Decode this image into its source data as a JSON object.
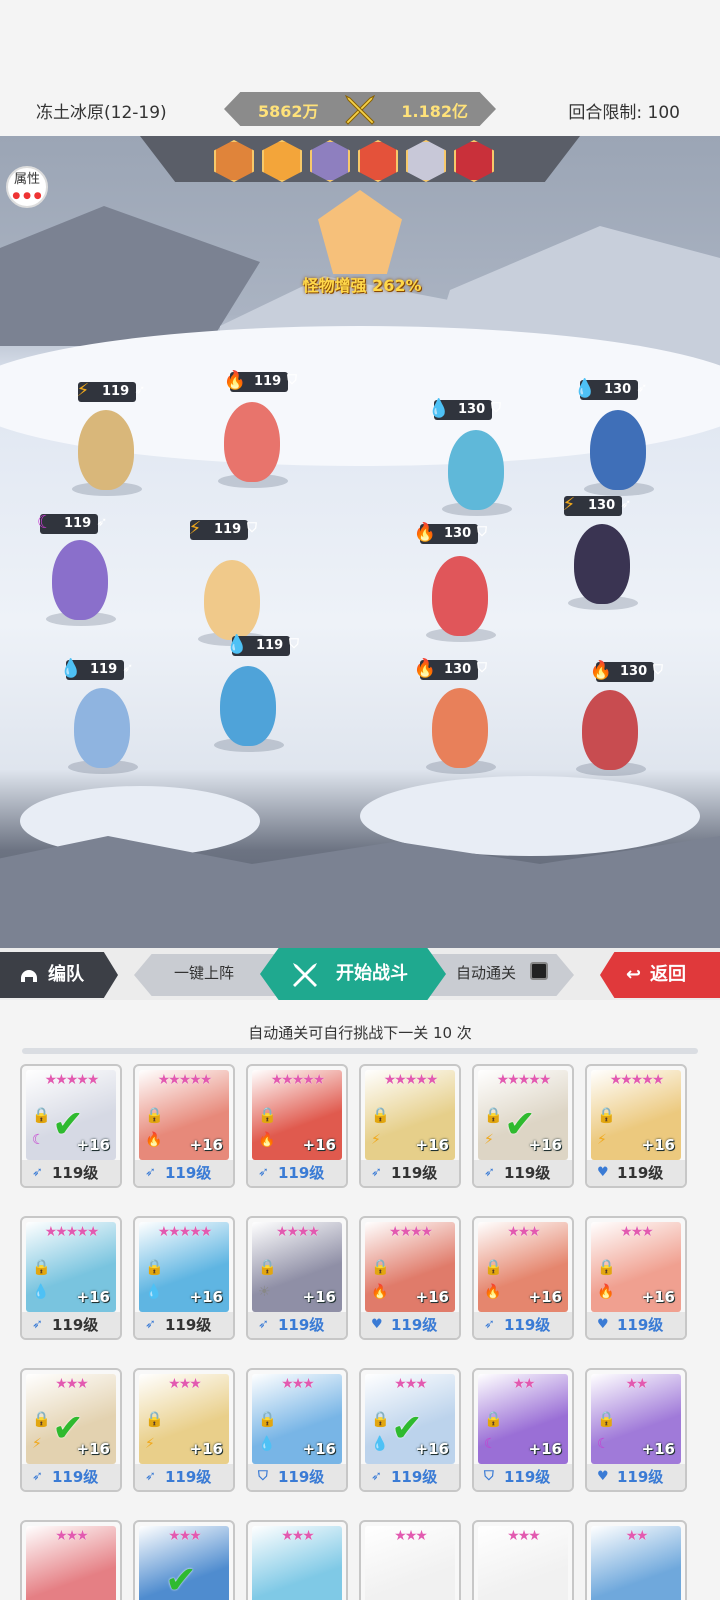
{
  "header": {
    "stage_name": "冻土冰原(12-19)",
    "power_self": "5862万",
    "power_enemy": "1.182亿",
    "round_limit": "回合限制: 100"
  },
  "battlefield": {
    "attr_button": "属性",
    "boss_buff": "怪物增强 262%",
    "enemy_portraits": [
      "#e0843a",
      "#f3a53a",
      "#8e7fbf",
      "#e4523a",
      "#c8c8d8",
      "#c9303a"
    ],
    "allies": [
      {
        "level": "119",
        "element": "thunder-icon",
        "class": "speed-icon",
        "color": "#d9b77a"
      },
      {
        "level": "119",
        "element": "fire-icon",
        "class": "shield-icon",
        "color": "#e8746c"
      },
      {
        "level": "119",
        "element": "moon-icon",
        "class": "speed-icon",
        "color": "#8a6fcb"
      },
      {
        "level": "119",
        "element": "thunder-icon",
        "class": "shield-icon",
        "color": "#f0c98a"
      },
      {
        "level": "119",
        "element": "water-icon",
        "class": "speed-icon",
        "color": "#8fb4e0"
      },
      {
        "level": "119",
        "element": "water-icon",
        "class": "shield-icon",
        "color": "#4fa3d9"
      }
    ],
    "enemies": [
      {
        "level": "130",
        "element": "water-icon",
        "class": "shield-icon",
        "color": "#5fb8d9"
      },
      {
        "level": "130",
        "element": "water-icon",
        "class": "speed-icon",
        "color": "#3f6fb8"
      },
      {
        "level": "130",
        "element": "fire-icon",
        "class": "shield-icon",
        "color": "#e0565a"
      },
      {
        "level": "130",
        "element": "thunder-icon",
        "class": "speed-icon",
        "color": "#3a3452"
      },
      {
        "level": "130",
        "element": "fire-icon",
        "class": "shield-icon",
        "color": "#e8805a"
      },
      {
        "level": "130",
        "element": "fire-icon",
        "class": "shield-icon",
        "color": "#c84c50"
      }
    ]
  },
  "controls": {
    "team_label": "编队",
    "one_key_label": "一键上阵",
    "start_label": "开始战斗",
    "auto_label": "自动通关",
    "back_label": "返回"
  },
  "hint": "自动通关可自行挑战下一关 10 次",
  "heroes": [
    {
      "level": "119级",
      "stars": "★★★★★",
      "element": "moon-icon",
      "class": "speed-icon",
      "check": true,
      "bg": "#d6d9e4",
      "blue": false
    },
    {
      "level": "119级",
      "stars": "★★★★★",
      "element": "fire-icon",
      "class": "speed-icon",
      "check": false,
      "bg": "#e7897a",
      "blue": true
    },
    {
      "level": "119级",
      "stars": "★★★★★",
      "element": "fire-icon",
      "class": "speed-icon",
      "check": false,
      "bg": "#e05a4e",
      "blue": true
    },
    {
      "level": "119级",
      "stars": "★★★★★",
      "element": "thunder-icon",
      "class": "speed-icon",
      "check": false,
      "bg": "#e6cf8a",
      "blue": false
    },
    {
      "level": "119级",
      "stars": "★★★★★",
      "element": "thunder-icon",
      "class": "speed-icon",
      "check": true,
      "bg": "#ddd5c5",
      "blue": false
    },
    {
      "level": "119级",
      "stars": "★★★★★",
      "element": "thunder-icon",
      "class": "heart-icon",
      "check": false,
      "bg": "#ecc97e",
      "blue": false
    },
    {
      "level": "119级",
      "stars": "★★★★★",
      "element": "water-icon",
      "class": "speed-icon",
      "check": false,
      "bg": "#79c4df",
      "blue": false
    },
    {
      "level": "119级",
      "stars": "★★★★★",
      "element": "water-icon",
      "class": "speed-icon",
      "check": false,
      "bg": "#5fb5e2",
      "blue": false
    },
    {
      "level": "119级",
      "stars": "★★★★",
      "element": "sun-icon",
      "class": "speed-icon",
      "check": false,
      "bg": "#8f8fa6",
      "blue": true
    },
    {
      "level": "119级",
      "stars": "★★★★",
      "element": "fire-icon",
      "class": "heart-icon",
      "check": false,
      "bg": "#e07b6a",
      "blue": true
    },
    {
      "level": "119级",
      "stars": "★★★",
      "element": "fire-icon",
      "class": "speed-icon",
      "check": false,
      "bg": "#e5866e",
      "blue": true
    },
    {
      "level": "119级",
      "stars": "★★★",
      "element": "fire-icon",
      "class": "heart-icon",
      "check": false,
      "bg": "#f0a090",
      "blue": true
    },
    {
      "level": "119级",
      "stars": "★★★",
      "element": "thunder-icon",
      "class": "speed-icon",
      "check": true,
      "bg": "#e3d2b0",
      "blue": true
    },
    {
      "level": "119级",
      "stars": "★★★",
      "element": "thunder-icon",
      "class": "speed-icon",
      "check": false,
      "bg": "#e9cf8a",
      "blue": true
    },
    {
      "level": "119级",
      "stars": "★★★",
      "element": "water-icon",
      "class": "shield-icon",
      "check": false,
      "bg": "#78b5e6",
      "blue": true
    },
    {
      "level": "119级",
      "stars": "★★★",
      "element": "water-icon",
      "class": "speed-icon",
      "check": true,
      "bg": "#bcd3ec",
      "blue": true
    },
    {
      "level": "119级",
      "stars": "★★",
      "element": "moon-icon",
      "class": "shield-icon",
      "check": false,
      "bg": "#9a6fd6",
      "blue": true
    },
    {
      "level": "119级",
      "stars": "★★",
      "element": "moon-icon",
      "class": "heart-icon",
      "check": false,
      "bg": "#a07ad9",
      "blue": true
    },
    {
      "level": "",
      "stars": "★★★",
      "element": "",
      "class": "",
      "check": false,
      "bg": "#e57f84",
      "blue": false
    },
    {
      "level": "",
      "stars": "★★★",
      "element": "",
      "class": "",
      "check": true,
      "bg": "#4f8ccf",
      "blue": false
    },
    {
      "level": "",
      "stars": "★★★",
      "element": "",
      "class": "",
      "check": false,
      "bg": "#7fc9e6",
      "blue": false
    },
    {
      "level": "",
      "stars": "★★★",
      "element": "",
      "class": "",
      "check": false,
      "bg": "#f1f1f1",
      "blue": false
    },
    {
      "level": "",
      "stars": "★★★",
      "element": "",
      "class": "",
      "check": false,
      "bg": "#f1f1f1",
      "blue": false
    },
    {
      "level": "",
      "stars": "★★",
      "element": "",
      "class": "",
      "check": false,
      "bg": "#6fa8dc",
      "blue": false
    }
  ]
}
